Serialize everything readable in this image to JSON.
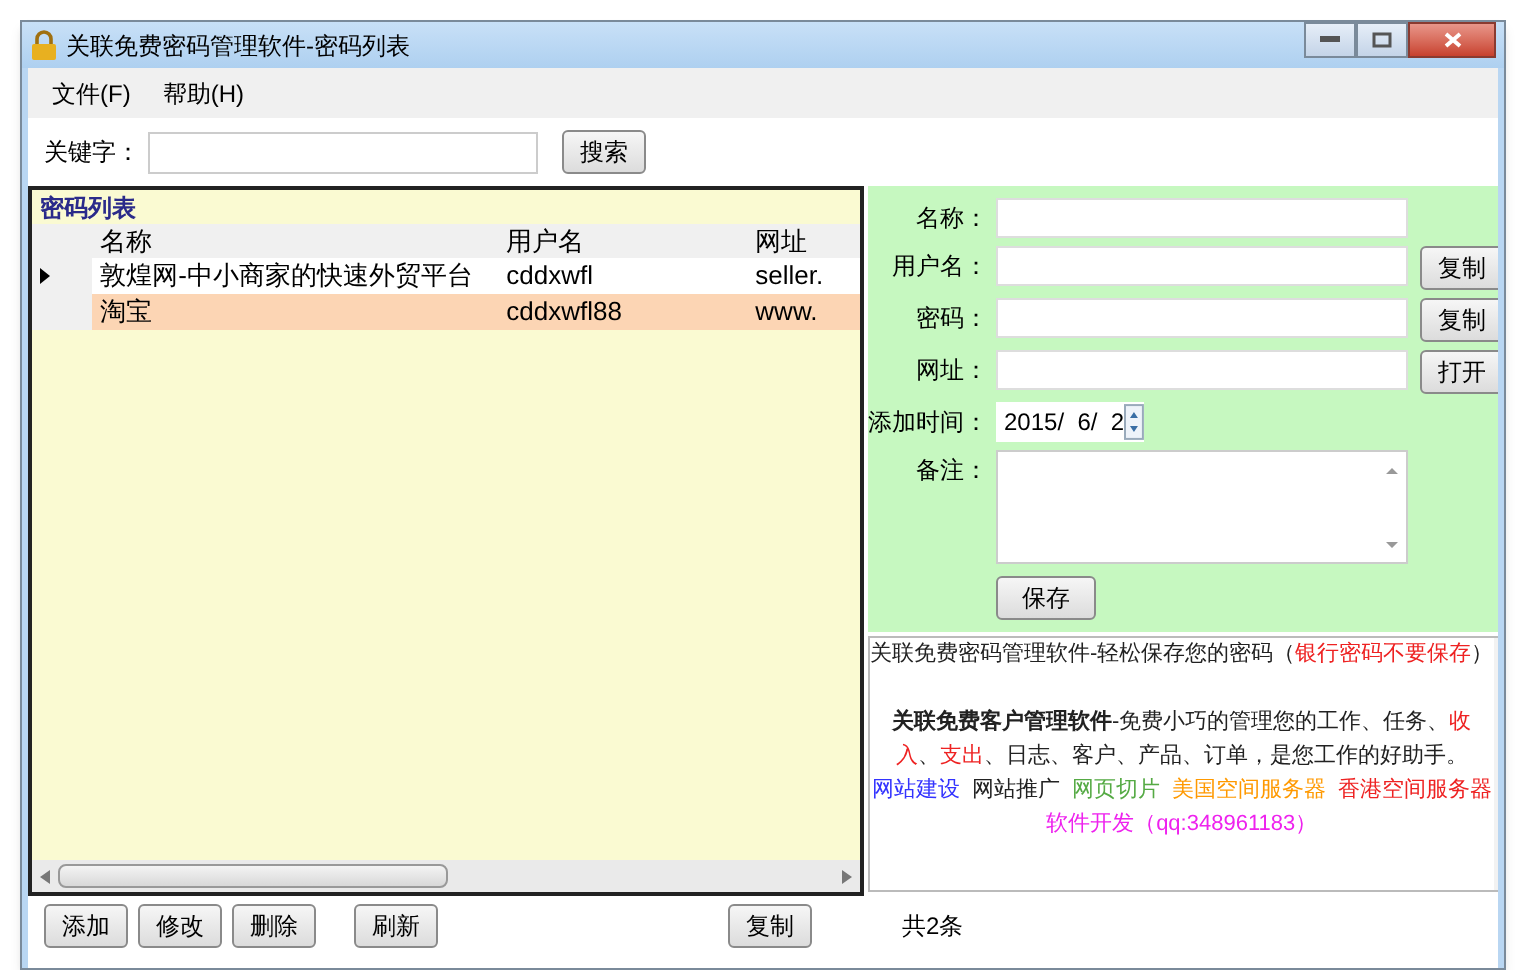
{
  "window": {
    "title": "关联免费密码管理软件-密码列表"
  },
  "menu": [
    "文件(F)",
    "帮助(H)"
  ],
  "search": {
    "label": "关键字：",
    "button": "搜索"
  },
  "list": {
    "title": "密码列表",
    "columns": [
      "名称",
      "用户名",
      "网址"
    ],
    "rows": [
      {
        "cells": [
          "敦煌网-中小商家的快速外贸平台",
          "cddxwfl",
          "seller."
        ],
        "current": true,
        "selected": false
      },
      {
        "cells": [
          "淘宝",
          "cddxwfl88",
          "www."
        ],
        "current": false,
        "selected": true
      }
    ]
  },
  "form": {
    "fields": [
      {
        "kind": "text",
        "label": "名称："
      },
      {
        "kind": "text",
        "label": "用户名：",
        "button": "复制"
      },
      {
        "kind": "text",
        "label": "密码：",
        "button": "复制"
      },
      {
        "kind": "text",
        "label": "网址：",
        "button": "打开"
      },
      {
        "kind": "date",
        "label": "添加时间：",
        "value": "2015/  6/  2"
      },
      {
        "kind": "memo",
        "label": "备注："
      }
    ],
    "save": "保存"
  },
  "info": {
    "paragraphs": [
      [
        {
          "text": "关联免费密码管理软件-轻松保存您的密码（",
          "kind": "plain"
        },
        {
          "text": "银行密码不要保存",
          "kind": "warning"
        },
        {
          "text": "）",
          "kind": "plain"
        }
      ],
      [
        {
          "text": "**关联免费客户管理软件**-免费小巧的管理您的工作、任务、",
          "kind": "plain"
        },
        {
          "text": "收入",
          "kind": "warning"
        },
        {
          "text": "、",
          "kind": "plain"
        },
        {
          "text": "支出",
          "kind": "warning"
        },
        {
          "text": "、日志、客户、产品、订单，是您工作的好助手。",
          "kind": "plain"
        }
      ]
    ],
    "links": [
      [
        {
          "text": "网站建设",
          "color": "#3333ff"
        },
        {
          "text": "网站推广",
          "color": "#222222"
        },
        {
          "text": "网页切片",
          "color": "#55aa44"
        },
        {
          "text": "美国空间服务器",
          "color": "#ff9900"
        },
        {
          "text": "香港空间服务器",
          "color": "#ee2222"
        }
      ],
      [
        {
          "text": "软件开发（qq:348961183）",
          "color": "#ee22ee"
        }
      ]
    ]
  },
  "buttons": [
    "添加",
    "修改",
    "删除",
    "刷新"
  ],
  "copy_button": "复制",
  "count": "共2条"
}
